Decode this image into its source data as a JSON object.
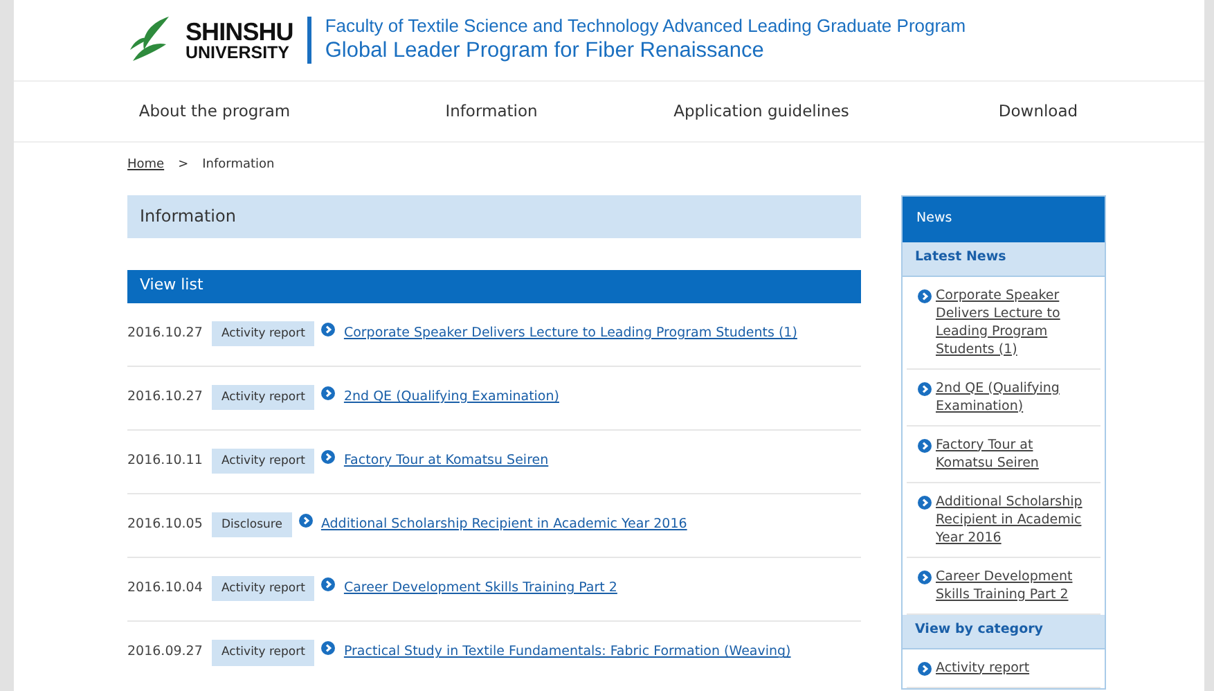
{
  "logo": {
    "line1": "SHINSHU",
    "line2": "UNIVERSITY"
  },
  "header": {
    "subtitle": "Faculty of Textile Science and Technology Advanced Leading Graduate Program",
    "title": "Global Leader Program for Fiber Renaissance"
  },
  "nav": [
    {
      "label": "About the program"
    },
    {
      "label": "Information"
    },
    {
      "label": "Application guidelines"
    },
    {
      "label": "Download"
    }
  ],
  "breadcrumb": {
    "home": "Home",
    "separator": ">",
    "current": "Information"
  },
  "page_title": "Information",
  "list_heading": "View list",
  "news_list": [
    {
      "date": "2016.10.27",
      "category": "Activity report",
      "title": "Corporate Speaker Delivers Lecture to Leading Program Students (1)"
    },
    {
      "date": "2016.10.27",
      "category": "Activity report",
      "title": "2nd QE (Qualifying Examination)"
    },
    {
      "date": "2016.10.11",
      "category": "Activity report",
      "title": "Factory Tour at Komatsu Seiren"
    },
    {
      "date": "2016.10.05",
      "category": "Disclosure",
      "title": "Additional Scholarship Recipient in Academic Year 2016"
    },
    {
      "date": "2016.10.04",
      "category": "Activity report",
      "title": "Career Development Skills Training Part 2"
    },
    {
      "date": "2016.09.27",
      "category": "Activity report",
      "title": "Practical Study in Textile Fundamentals: Fabric Formation (Weaving)"
    }
  ],
  "sidebar": {
    "title": "News",
    "sections": [
      {
        "heading": "Latest News",
        "items": [
          "Corporate Speaker Delivers Lecture to Leading Program Students (1)",
          "2nd QE (Qualifying Examination)",
          "Factory Tour at Komatsu Seiren",
          "Additional Scholarship Recipient in Academic Year 2016",
          "Career Development Skills Training Part 2"
        ]
      },
      {
        "heading": "View by category",
        "items": [
          "Activity report"
        ]
      }
    ]
  }
}
